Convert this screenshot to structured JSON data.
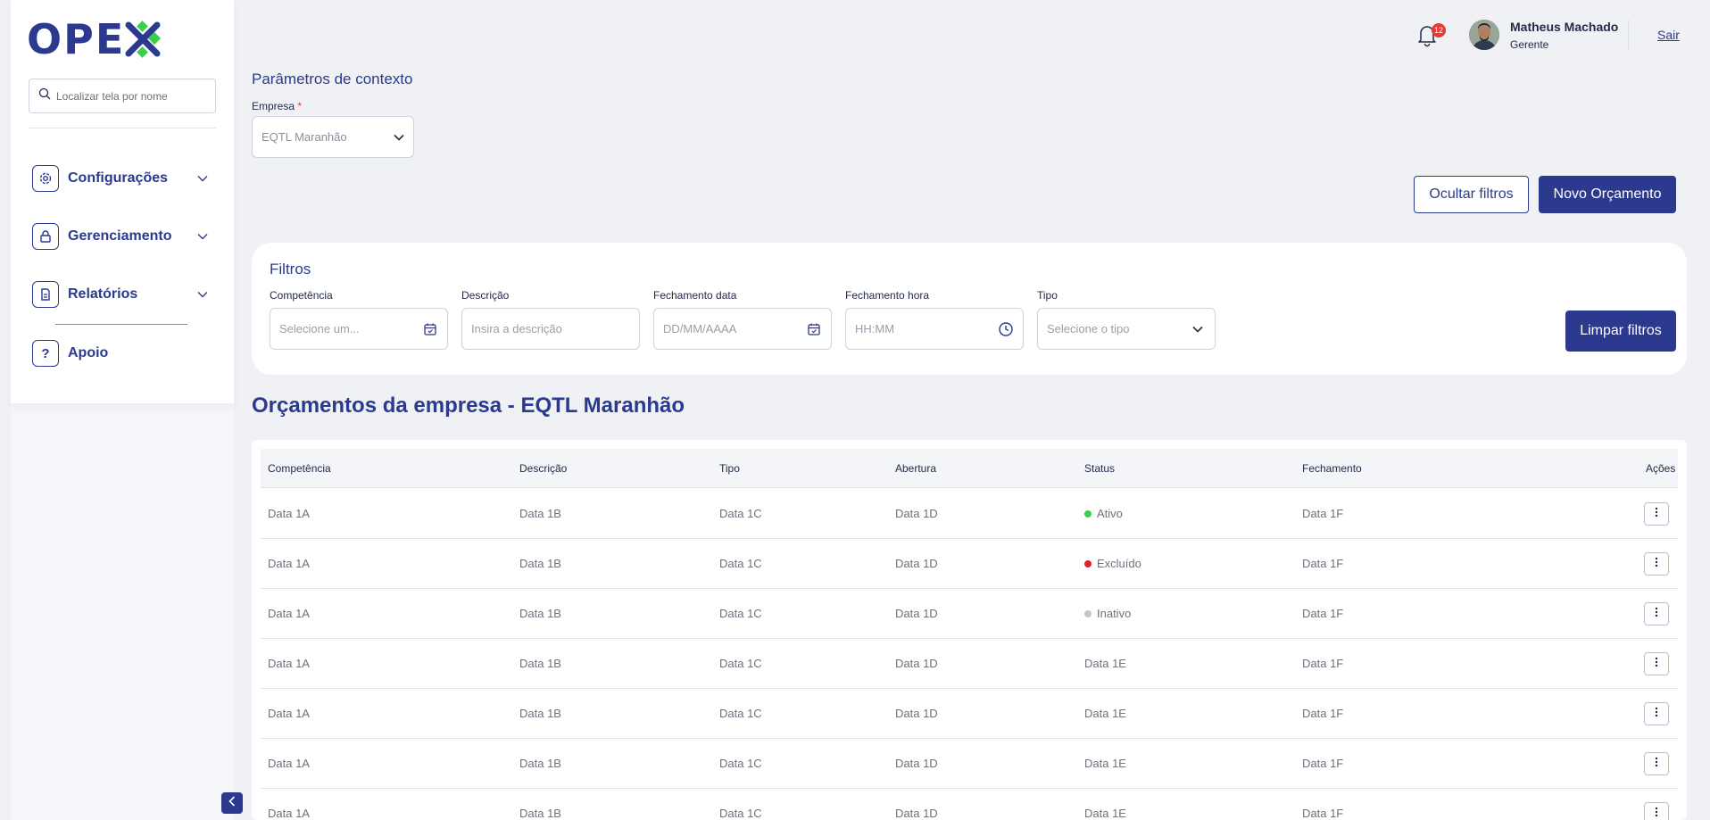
{
  "app": {
    "logo_text": "OPE",
    "logo_accent_color": "#3ccf4e",
    "brand_color": "#2b3a8f"
  },
  "sidebar": {
    "search_placeholder": "Localizar tela por nome",
    "items": [
      {
        "label": "Configurações",
        "icon": "gear-icon"
      },
      {
        "label": "Gerenciamento",
        "icon": "lock-icon"
      },
      {
        "label": "Relatórios",
        "icon": "document-icon"
      },
      {
        "label": "Apoio",
        "icon": "question-icon"
      }
    ]
  },
  "header": {
    "notification_count": "12",
    "user_name": "Matheus Machado",
    "user_role": "Gerente",
    "logout_label": "Sair"
  },
  "context": {
    "title": "Parâmetros de contexto",
    "empresa_label": "Empresa",
    "empresa_required_mark": "*",
    "empresa_value": "EQTL Maranhão"
  },
  "actions": {
    "hide_filters_label": "Ocultar filtros",
    "new_budget_label": "Novo Orçamento"
  },
  "filters": {
    "title": "Filtros",
    "fields": [
      {
        "label": "Competência",
        "placeholder": "Selecione um...",
        "icon": "calendar-icon"
      },
      {
        "label": "Descrição",
        "placeholder": "Insira a descrição",
        "icon": ""
      },
      {
        "label": "Fechamento data",
        "placeholder": "DD/MM/AAAA",
        "icon": "calendar-icon"
      },
      {
        "label": "Fechamento hora",
        "placeholder": "HH:MM",
        "icon": "clock-icon"
      },
      {
        "label": "Tipo",
        "placeholder": "Selecione o tipo",
        "icon": "chevron-down-icon"
      }
    ],
    "clear_label": "Limpar filtros"
  },
  "table": {
    "title": "Orçamentos da empresa - EQTL Maranhão",
    "columns": [
      "Competência",
      "Descrição",
      "Tipo",
      "Abertura",
      "Status",
      "Fechamento",
      "Ações"
    ],
    "rows": [
      {
        "competencia": "Data 1A",
        "descricao": "Data 1B",
        "tipo": "Data 1C",
        "abertura": "Data 1D",
        "status": "Ativo",
        "status_color": "#3ccf4e",
        "fechamento": "Data 1F"
      },
      {
        "competencia": "Data 1A",
        "descricao": "Data 1B",
        "tipo": "Data 1C",
        "abertura": "Data 1D",
        "status": "Excluído",
        "status_color": "#e0202a",
        "fechamento": "Data 1F"
      },
      {
        "competencia": "Data 1A",
        "descricao": "Data 1B",
        "tipo": "Data 1C",
        "abertura": "Data 1D",
        "status": "Inativo",
        "status_color": "#c4c6cc",
        "fechamento": "Data 1F"
      },
      {
        "competencia": "Data 1A",
        "descricao": "Data 1B",
        "tipo": "Data 1C",
        "abertura": "Data 1D",
        "status": "Data 1E",
        "status_color": "",
        "fechamento": "Data 1F"
      },
      {
        "competencia": "Data 1A",
        "descricao": "Data 1B",
        "tipo": "Data 1C",
        "abertura": "Data 1D",
        "status": "Data 1E",
        "status_color": "",
        "fechamento": "Data 1F"
      },
      {
        "competencia": "Data 1A",
        "descricao": "Data 1B",
        "tipo": "Data 1C",
        "abertura": "Data 1D",
        "status": "Data 1E",
        "status_color": "",
        "fechamento": "Data 1F"
      },
      {
        "competencia": "Data 1A",
        "descricao": "Data 1B",
        "tipo": "Data 1C",
        "abertura": "Data 1D",
        "status": "Data 1E",
        "status_color": "",
        "fechamento": "Data 1F"
      }
    ]
  }
}
